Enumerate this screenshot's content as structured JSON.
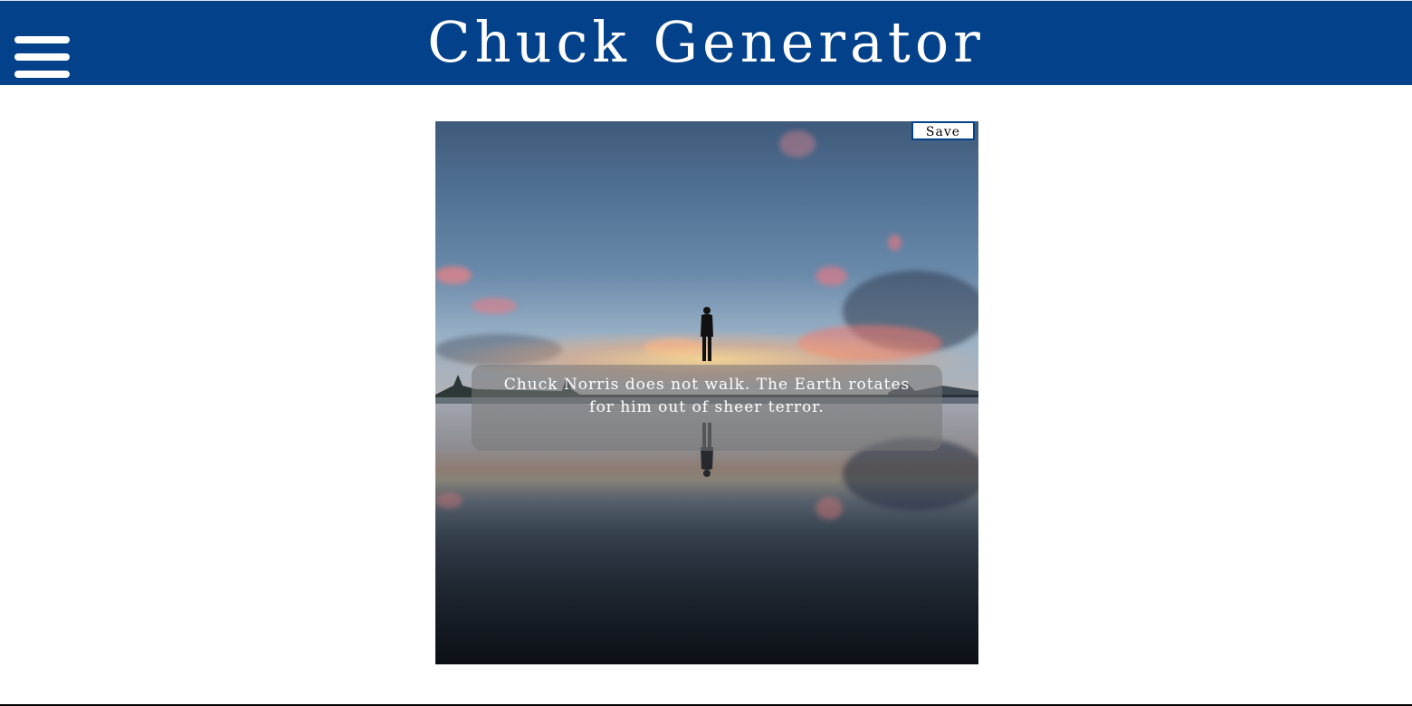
{
  "app": {
    "title": "Chuck Generator"
  },
  "header": {
    "menu_icon": "hamburger-menu-icon",
    "background_color": "#03428a"
  },
  "card": {
    "save_label": "Save",
    "quote": "Chuck Norris does not walk. The Earth rotates for him out of sheer terror.",
    "image_description_icon": "sunset-lake-silhouette"
  }
}
